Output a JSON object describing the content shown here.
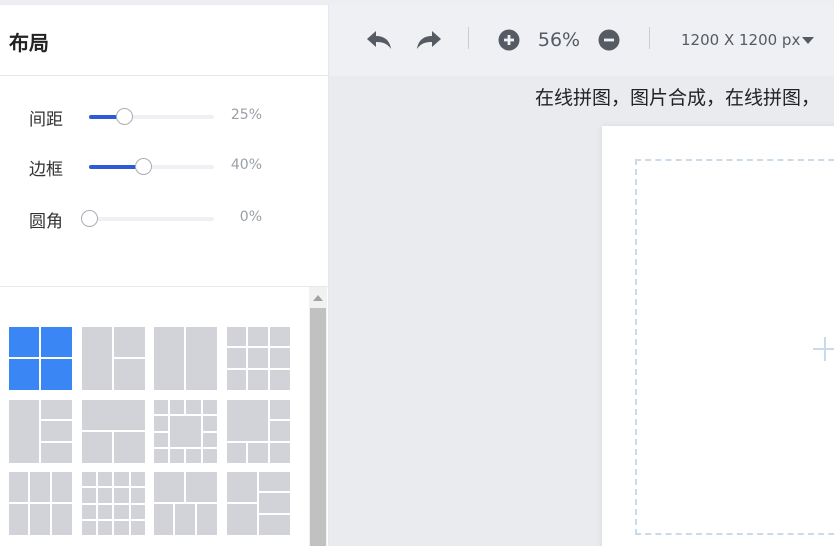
{
  "panel": {
    "title": "布局",
    "sliders": [
      {
        "label": "间距",
        "value": "25%",
        "fraction": 0.25
      },
      {
        "label": "边框",
        "value": "40%",
        "fraction": 0.4
      },
      {
        "label": "圆角",
        "value": "0%",
        "fraction": 0.0
      }
    ],
    "layouts": [
      {
        "name": "four-equal",
        "selected": true
      },
      {
        "name": "one-left-two-right",
        "selected": false
      },
      {
        "name": "two-columns",
        "selected": false
      },
      {
        "name": "three-by-three",
        "selected": false
      },
      {
        "name": "left-tall-three-right",
        "selected": false
      },
      {
        "name": "wide-top-two-bottom",
        "selected": false
      },
      {
        "name": "center-frame-ring",
        "selected": false
      },
      {
        "name": "big-top-left-mosaic",
        "selected": false
      },
      {
        "name": "three-top-three-bottom",
        "selected": false
      },
      {
        "name": "four-by-four",
        "selected": false
      },
      {
        "name": "two-top-three-bottom",
        "selected": false
      },
      {
        "name": "left-column-right-stack",
        "selected": false
      }
    ]
  },
  "toolbar": {
    "undo_icon": "undo-icon",
    "redo_icon": "redo-icon",
    "zoom_in_icon": "zoom-in-icon",
    "zoom_out_icon": "zoom-out-icon",
    "zoom": "56%",
    "size": "1200 X 1200 px"
  },
  "canvas": {
    "marquee": "在线拼图，图片合成，在线拼图，",
    "add_icon": "plus-icon"
  },
  "colors": {
    "accent": "#2d5bd6",
    "selected_tile": "#3b86f5",
    "tile": "#d1d3d9"
  }
}
